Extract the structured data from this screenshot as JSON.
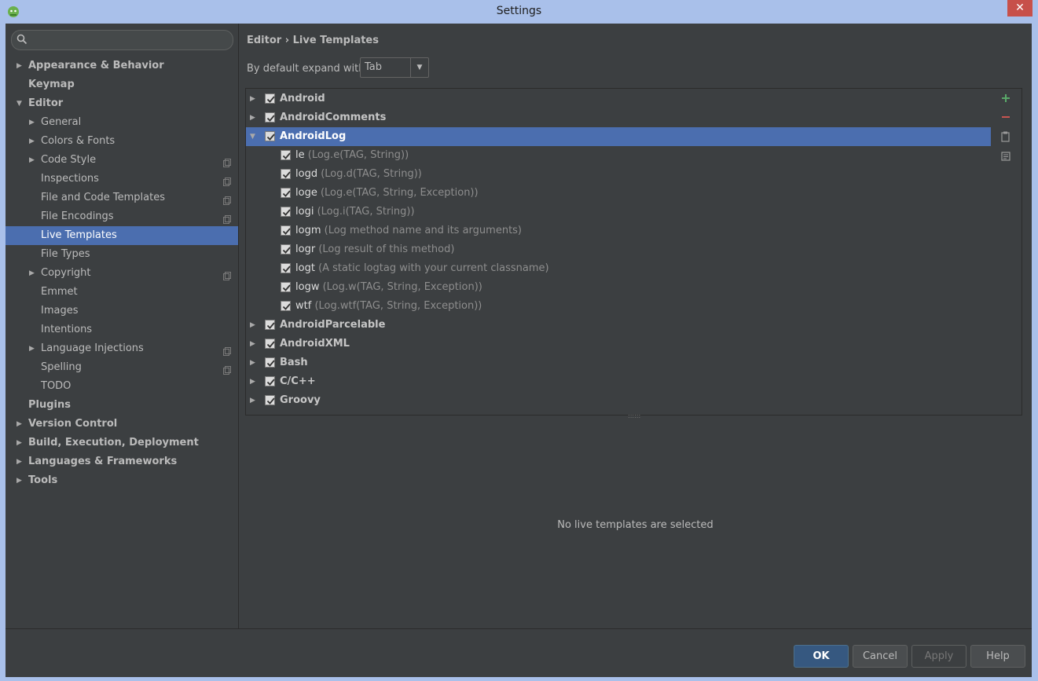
{
  "window": {
    "title": "Settings"
  },
  "search": {
    "placeholder": ""
  },
  "sidebar": {
    "items": [
      {
        "label": "Appearance & Behavior",
        "arrow": "right",
        "bold": true,
        "level": 0
      },
      {
        "label": "Keymap",
        "arrow": "none",
        "bold": true,
        "level": 0
      },
      {
        "label": "Editor",
        "arrow": "down",
        "bold": true,
        "level": 0
      },
      {
        "label": "General",
        "arrow": "right",
        "bold": false,
        "level": 1
      },
      {
        "label": "Colors & Fonts",
        "arrow": "right",
        "bold": false,
        "level": 1
      },
      {
        "label": "Code Style",
        "arrow": "right",
        "bold": false,
        "level": 1,
        "copy": true
      },
      {
        "label": "Inspections",
        "arrow": "none",
        "bold": false,
        "level": 1,
        "copy": true
      },
      {
        "label": "File and Code Templates",
        "arrow": "none",
        "bold": false,
        "level": 1,
        "copy": true
      },
      {
        "label": "File Encodings",
        "arrow": "none",
        "bold": false,
        "level": 1,
        "copy": true
      },
      {
        "label": "Live Templates",
        "arrow": "none",
        "bold": false,
        "level": 1,
        "selected": true
      },
      {
        "label": "File Types",
        "arrow": "none",
        "bold": false,
        "level": 1
      },
      {
        "label": "Copyright",
        "arrow": "right",
        "bold": false,
        "level": 1,
        "copy": true
      },
      {
        "label": "Emmet",
        "arrow": "none",
        "bold": false,
        "level": 1
      },
      {
        "label": "Images",
        "arrow": "none",
        "bold": false,
        "level": 1
      },
      {
        "label": "Intentions",
        "arrow": "none",
        "bold": false,
        "level": 1
      },
      {
        "label": "Language Injections",
        "arrow": "right",
        "bold": false,
        "level": 1,
        "copy": true
      },
      {
        "label": "Spelling",
        "arrow": "none",
        "bold": false,
        "level": 1,
        "copy": true
      },
      {
        "label": "TODO",
        "arrow": "none",
        "bold": false,
        "level": 1
      },
      {
        "label": "Plugins",
        "arrow": "none",
        "bold": true,
        "level": 0
      },
      {
        "label": "Version Control",
        "arrow": "right",
        "bold": true,
        "level": 0
      },
      {
        "label": "Build, Execution, Deployment",
        "arrow": "right",
        "bold": true,
        "level": 0
      },
      {
        "label": "Languages & Frameworks",
        "arrow": "right",
        "bold": true,
        "level": 0
      },
      {
        "label": "Tools",
        "arrow": "right",
        "bold": true,
        "level": 0
      }
    ]
  },
  "breadcrumb": {
    "parent": "Editor",
    "separator": "›",
    "current": "Live Templates"
  },
  "expand": {
    "label": "By default expand with",
    "value": "Tab"
  },
  "templates": {
    "groups": [
      {
        "name": "Android",
        "expanded": false,
        "checked": true
      },
      {
        "name": "AndroidComments",
        "expanded": false,
        "checked": true
      },
      {
        "name": "AndroidLog",
        "expanded": true,
        "checked": true,
        "selected": true,
        "items": [
          {
            "name": "le",
            "desc": "(Log.e(TAG, String))",
            "checked": true
          },
          {
            "name": "logd",
            "desc": "(Log.d(TAG, String))",
            "checked": true
          },
          {
            "name": "loge",
            "desc": "(Log.e(TAG, String, Exception))",
            "checked": true
          },
          {
            "name": "logi",
            "desc": "(Log.i(TAG, String))",
            "checked": true
          },
          {
            "name": "logm",
            "desc": "(Log method name and its arguments)",
            "checked": true
          },
          {
            "name": "logr",
            "desc": "(Log result of this method)",
            "checked": true
          },
          {
            "name": "logt",
            "desc": "(A static logtag with your current classname)",
            "checked": true
          },
          {
            "name": "logw",
            "desc": "(Log.w(TAG, String, Exception))",
            "checked": true
          },
          {
            "name": "wtf",
            "desc": "(Log.wtf(TAG, String, Exception))",
            "checked": true
          }
        ]
      },
      {
        "name": "AndroidParcelable",
        "expanded": false,
        "checked": true
      },
      {
        "name": "AndroidXML",
        "expanded": false,
        "checked": true
      },
      {
        "name": "Bash",
        "expanded": false,
        "checked": true
      },
      {
        "name": "C/C++",
        "expanded": false,
        "checked": true
      },
      {
        "name": "Groovy",
        "expanded": false,
        "checked": true
      }
    ]
  },
  "toolbar": {
    "add_icon": "plus-icon",
    "remove_icon": "minus-icon",
    "copy_icon": "copy-icon",
    "edit_icon": "edit-icon"
  },
  "empty_message": "No live templates are selected",
  "buttons": {
    "ok": "OK",
    "cancel": "Cancel",
    "apply": "Apply",
    "help": "Help"
  },
  "colors": {
    "selection": "#4b6eaf",
    "background": "#3c3f41",
    "titlebar": "#a9c0ea",
    "add": "#59a869",
    "remove": "#c75450"
  }
}
